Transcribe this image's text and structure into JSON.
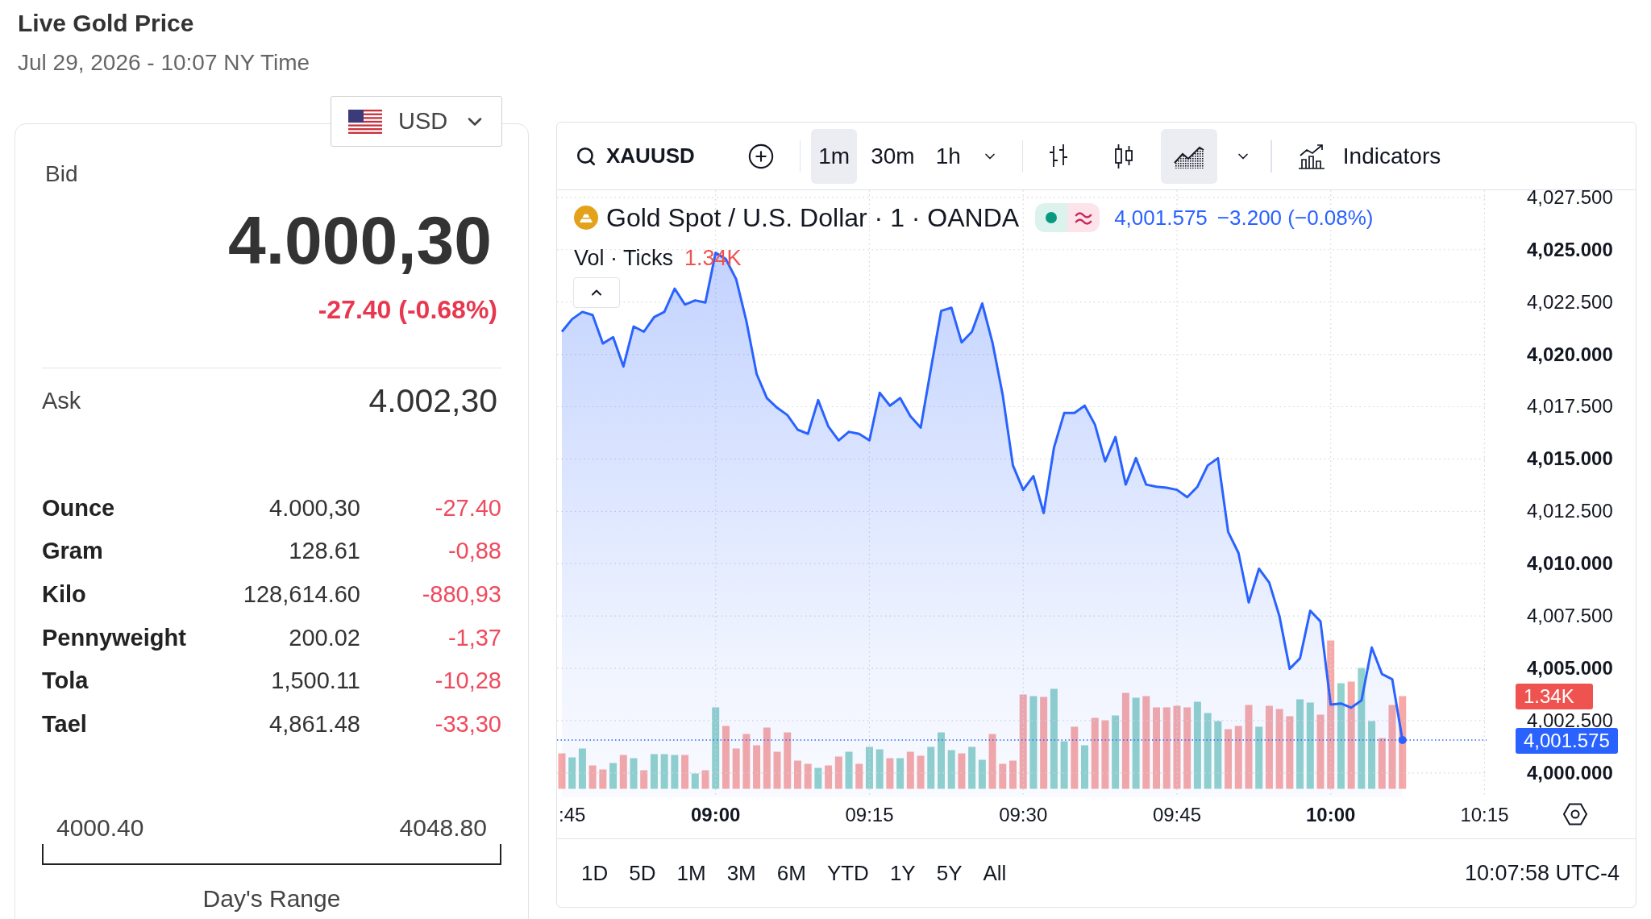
{
  "header": {
    "title": "Live Gold Price",
    "timestamp": "Jul 29, 2026 - 10:07 NY Time"
  },
  "price_card": {
    "currency": "USD",
    "bid": {
      "label": "Bid",
      "value": "4.000,30",
      "change": "-27.40 (-0.68%)",
      "negative": true
    },
    "ask": {
      "label": "Ask",
      "value": "4.002,30"
    },
    "units": [
      {
        "unit": "Ounce",
        "price": "4.000,30",
        "change": "-27.40",
        "negative": true
      },
      {
        "unit": "Gram",
        "price": "128.61",
        "change": "-0,88",
        "negative": true
      },
      {
        "unit": "Kilo",
        "price": "128,614.60",
        "change": "-880,93",
        "negative": true
      },
      {
        "unit": "Pennyweight",
        "price": "200.02",
        "change": "-1,37",
        "negative": true
      },
      {
        "unit": "Tola",
        "price": "1,500.11",
        "change": "-10,28",
        "negative": true
      },
      {
        "unit": "Tael",
        "price": "4,861.48",
        "change": "-33,30",
        "negative": true
      }
    ],
    "days_range": {
      "low": "4000.40",
      "high": "4048.80",
      "label": "Day's Range"
    }
  },
  "chart": {
    "toolbar": {
      "symbol": "XAUUSD",
      "intervals": [
        {
          "label": "1m",
          "selected": true
        },
        {
          "label": "30m",
          "selected": false
        },
        {
          "label": "1h",
          "selected": false
        }
      ],
      "chart_types": [
        {
          "kind": "bars",
          "selected": false
        },
        {
          "kind": "candles",
          "selected": false
        },
        {
          "kind": "area",
          "selected": true
        }
      ],
      "indicators": "Indicators"
    },
    "legend": {
      "last": "4,001.575",
      "change": "−3.200 (−0.08%)",
      "volume_label": "Vol · Ticks",
      "volume_value": "1.34K"
    },
    "price_tags": {
      "volume": "1.34K",
      "last_price": "4,001.575"
    },
    "x_axis_cut_label": ":45",
    "chart_data": {
      "type": "area",
      "x": [
        525,
        526,
        527,
        528,
        529,
        530,
        531,
        532,
        533,
        534,
        535,
        536,
        537,
        538,
        539,
        540,
        541,
        542,
        543,
        544,
        545,
        546,
        547,
        548,
        549,
        550,
        551,
        552,
        553,
        554,
        555,
        556,
        557,
        558,
        559,
        560,
        561,
        562,
        563,
        564,
        565,
        566,
        567,
        568,
        569,
        570,
        571,
        572,
        573,
        574,
        575,
        576,
        577,
        578,
        579,
        580,
        581,
        582,
        583,
        584,
        585,
        586,
        587,
        588,
        589,
        590,
        591,
        592,
        593,
        594,
        595,
        596,
        597,
        598,
        599,
        600,
        601,
        602,
        603,
        604,
        605,
        606,
        607
      ],
      "series": [
        {
          "name": "Gold Spot / U.S. Dollar · 1 · OANDA",
          "color": "#2962ff",
          "values": [
            4021.08,
            4021.68,
            4022.03,
            4021.88,
            4020.52,
            4020.82,
            4019.42,
            4021.33,
            4021.08,
            4021.78,
            4022.03,
            4023.14,
            4022.38,
            4022.58,
            4022.48,
            4024.85,
            4024.55,
            4023.59,
            4021.58,
            4019.06,
            4017.91,
            4017.45,
            4017.1,
            4016.4,
            4016.2,
            4017.81,
            4016.55,
            4015.89,
            4016.3,
            4016.2,
            4015.89,
            4018.16,
            4017.55,
            4017.91,
            4017.05,
            4016.5,
            4019.32,
            4022.08,
            4022.23,
            4020.57,
            4021.08,
            4022.43,
            4020.57,
            4018.06,
            4014.69,
            4013.53,
            4014.18,
            4012.42,
            4015.54,
            4017.2,
            4017.2,
            4017.55,
            4016.65,
            4014.89,
            4016.05,
            4013.78,
            4015.04,
            4013.78,
            4013.68,
            4013.63,
            4013.53,
            4013.18,
            4013.68,
            4014.69,
            4015.04,
            4011.52,
            4010.51,
            4008.15,
            4009.76,
            4009.1,
            4007.49,
            4004.98,
            4005.48,
            4007.75,
            4007.24,
            4003.27,
            4003.32,
            4003.12,
            4003.47,
            4005.99,
            4004.73,
            4004.48,
            4001.575
          ]
        }
      ],
      "xlim": [
        524.53,
        615.2
      ],
      "ylim": [
        3998.84,
        4027.84
      ],
      "xticks": [
        {
          "value": 540,
          "label": "09:00"
        },
        {
          "value": 555,
          "label": "09:15"
        },
        {
          "value": 570,
          "label": "09:30"
        },
        {
          "value": 585,
          "label": "09:45"
        },
        {
          "value": 600,
          "label": "10:00"
        },
        {
          "value": 615,
          "label": "10:15"
        }
      ],
      "yticks": [
        {
          "value": 4000,
          "label": "4,000.000"
        },
        {
          "value": 4002.5,
          "label": "4,002.500"
        },
        {
          "value": 4005,
          "label": "4,005.000"
        },
        {
          "value": 4007.5,
          "label": "4,007.500"
        },
        {
          "value": 4010,
          "label": "4,010.000"
        },
        {
          "value": 4012.5,
          "label": "4,012.500"
        },
        {
          "value": 4015,
          "label": "4,015.000"
        },
        {
          "value": 4017.5,
          "label": "4,017.500"
        },
        {
          "value": 4020,
          "label": "4,020.000"
        },
        {
          "value": 4022.5,
          "label": "4,022.500"
        },
        {
          "value": 4025,
          "label": "4,025.000"
        },
        {
          "value": 4027.5,
          "label": "4,027.500"
        }
      ],
      "grid": true,
      "ref_lines": [
        {
          "axis": "y",
          "value": 4001.575,
          "color": "#2962ff"
        }
      ]
    },
    "ranges": [
      {
        "label": "1D",
        "selected": false
      },
      {
        "label": "5D",
        "selected": false
      },
      {
        "label": "1M",
        "selected": false
      },
      {
        "label": "3M",
        "selected": false
      },
      {
        "label": "6M",
        "selected": false
      },
      {
        "label": "YTD",
        "selected": false
      },
      {
        "label": "1Y",
        "selected": false
      },
      {
        "label": "5Y",
        "selected": false
      },
      {
        "label": "All",
        "selected": false
      }
    ],
    "clock": "10:07:58 UTC-4"
  }
}
